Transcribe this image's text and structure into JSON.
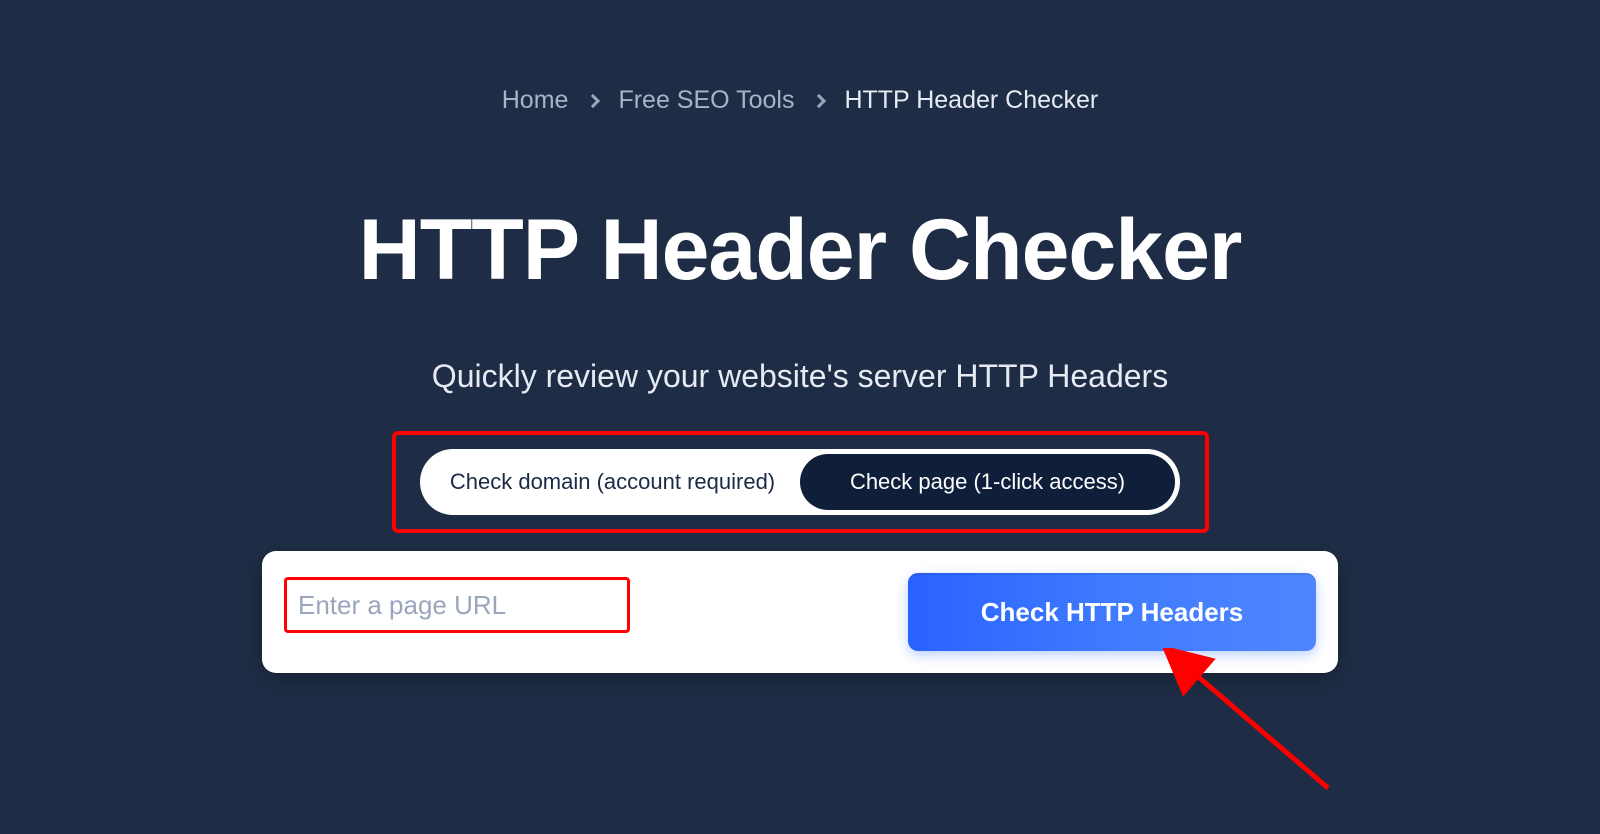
{
  "breadcrumb": {
    "items": [
      {
        "label": "Home"
      },
      {
        "label": "Free SEO Tools"
      },
      {
        "label": "HTTP Header Checker"
      }
    ]
  },
  "hero": {
    "title": "HTTP Header Checker",
    "subtitle": "Quickly review your website's server HTTP Headers"
  },
  "toggle": {
    "option_a": "Check domain (account required)",
    "option_b": "Check page (1-click access)",
    "active_index": 1
  },
  "form": {
    "url_value": "",
    "url_placeholder": "Enter a page URL",
    "submit_label": "Check HTTP Headers"
  },
  "annotations": {
    "highlight_toggle": true,
    "highlight_input": true,
    "arrow_color": "#ff0000"
  },
  "colors": {
    "bg": "#1e2d45",
    "accent": "#3f7bff",
    "pill_dark": "#0f1f3a"
  }
}
